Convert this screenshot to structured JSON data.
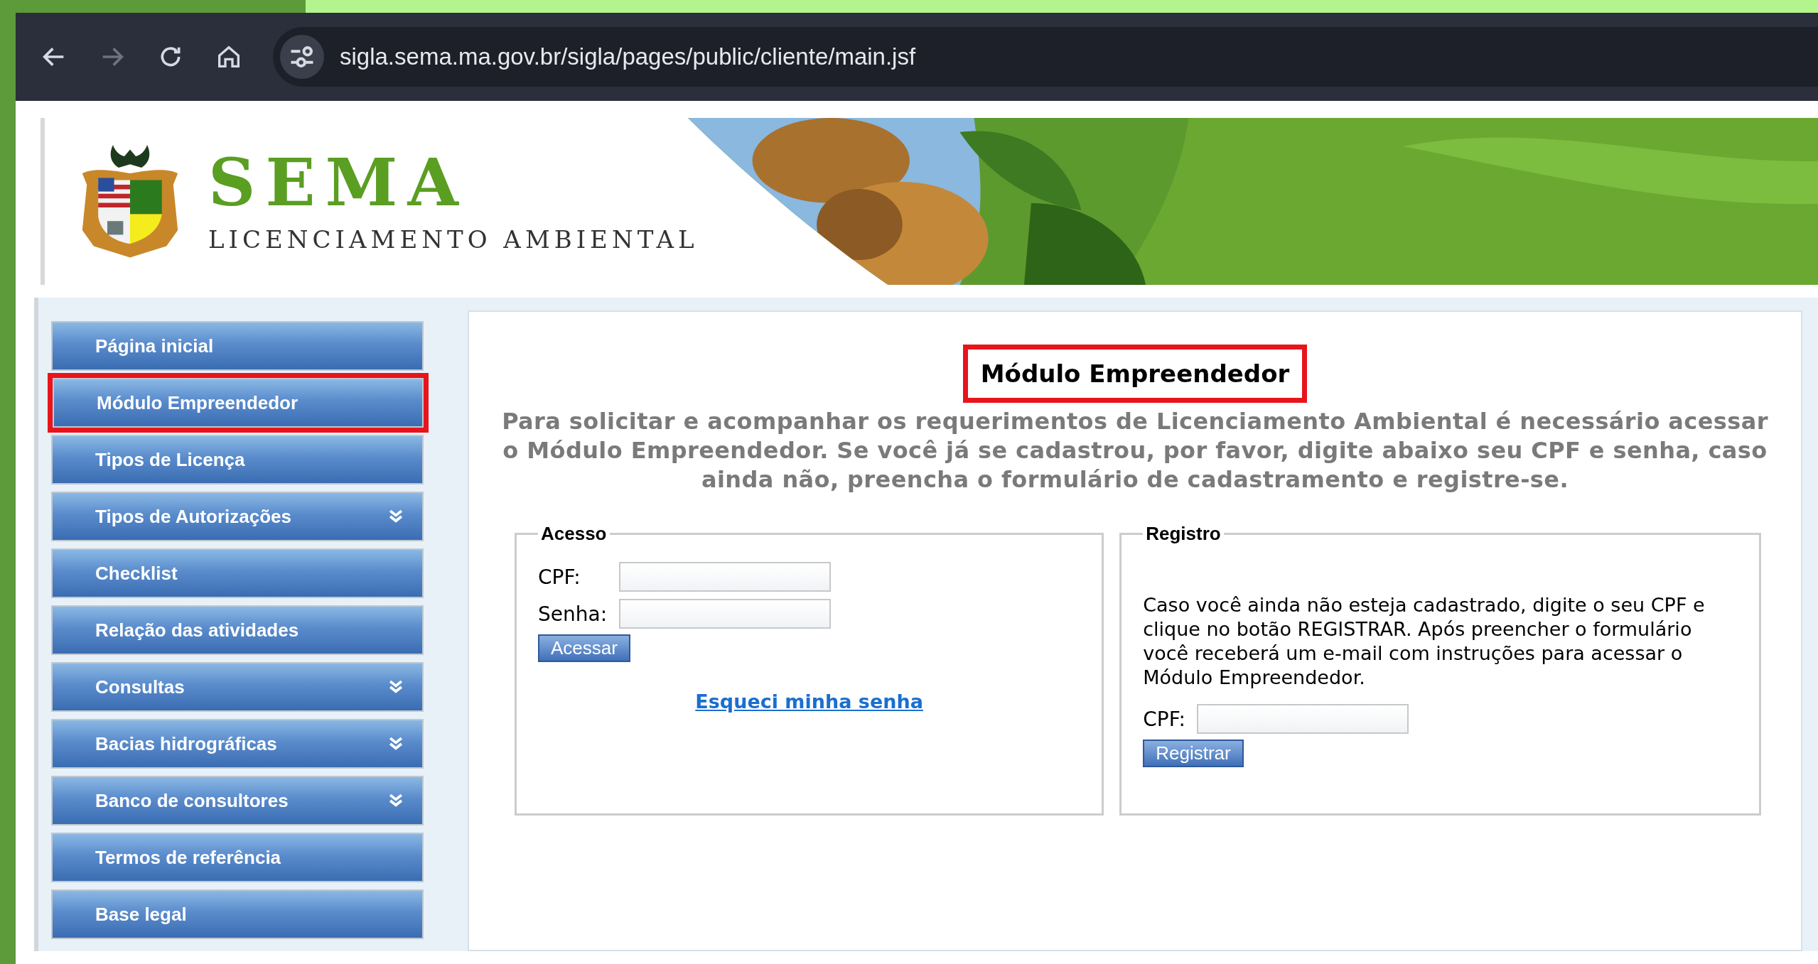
{
  "browser": {
    "url": "sigla.sema.ma.gov.br/sigla/pages/public/cliente/main.jsf"
  },
  "header": {
    "title": "SEMA",
    "subtitle": "LICENCIAMENTO AMBIENTAL"
  },
  "sidebar": {
    "items": [
      {
        "label": "Página inicial",
        "has_submenu": false,
        "highlighted": false
      },
      {
        "label": "Módulo Empreendedor",
        "has_submenu": false,
        "highlighted": true
      },
      {
        "label": "Tipos de Licença",
        "has_submenu": false,
        "highlighted": false
      },
      {
        "label": "Tipos de Autorizações",
        "has_submenu": true,
        "highlighted": false
      },
      {
        "label": "Checklist",
        "has_submenu": false,
        "highlighted": false
      },
      {
        "label": "Relação das atividades",
        "has_submenu": false,
        "highlighted": false
      },
      {
        "label": "Consultas",
        "has_submenu": true,
        "highlighted": false
      },
      {
        "label": "Bacias hidrográficas",
        "has_submenu": true,
        "highlighted": false
      },
      {
        "label": "Banco de consultores",
        "has_submenu": true,
        "highlighted": false
      },
      {
        "label": "Termos de referência",
        "has_submenu": false,
        "highlighted": false
      },
      {
        "label": "Base legal",
        "has_submenu": false,
        "highlighted": false
      }
    ]
  },
  "main": {
    "title": "Módulo Empreendedor",
    "title_highlighted": true,
    "intro": "Para solicitar e acompanhar os requerimentos de Licenciamento Ambiental é necessário acessar o Módulo Empreendedor. Se você já se cadastrou, por favor, digite abaixo seu CPF e senha, caso ainda não, preencha o formulário de cadastramento e registre-se.",
    "access": {
      "legend": "Acesso",
      "fields": [
        {
          "label": "CPF:"
        },
        {
          "label": "Senha:"
        }
      ],
      "button": "Acessar",
      "link": "Esqueci minha senha"
    },
    "register": {
      "legend": "Registro",
      "text": "Caso você ainda não esteja cadastrado, digite o seu CPF e clique no botão REGISTRAR. Após preencher o formulário você receberá um e-mail com instruções para acessar o Módulo Empreendedor.",
      "fields": [
        {
          "label": "CPF:"
        }
      ],
      "button": "Registrar"
    }
  }
}
